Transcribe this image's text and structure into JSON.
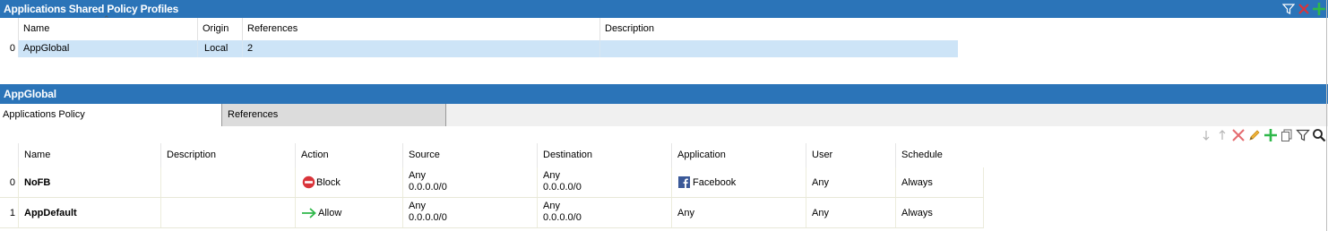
{
  "profiles_panel": {
    "title": "Applications Shared Policy Profiles",
    "columns": [
      "Name",
      "Origin",
      "References",
      "Description"
    ],
    "rows": [
      {
        "index": "0",
        "name": "AppGlobal",
        "origin": "Local",
        "references": "2",
        "description": ""
      }
    ]
  },
  "detail_panel": {
    "title": "AppGlobal",
    "tabs": [
      "Applications Policy",
      "References"
    ]
  },
  "policy_grid": {
    "columns": [
      "Name",
      "Description",
      "Action",
      "Source",
      "Destination",
      "Application",
      "User",
      "Schedule"
    ],
    "rows": [
      {
        "index": "0",
        "name": "NoFB",
        "description": "",
        "action": "Block",
        "action_icon": "block-icon",
        "source_line1": "Any",
        "source_line2": "0.0.0.0/0",
        "dest_line1": "Any",
        "dest_line2": "0.0.0.0/0",
        "application": "Facebook",
        "app_icon": "facebook-icon",
        "user": "Any",
        "schedule": "Always"
      },
      {
        "index": "1",
        "name": "AppDefault",
        "description": "",
        "action": "Allow",
        "action_icon": "arrow-right-icon",
        "source_line1": "Any",
        "source_line2": "0.0.0.0/0",
        "dest_line1": "Any",
        "dest_line2": "0.0.0.0/0",
        "application": "Any",
        "user": "Any",
        "schedule": "Always"
      }
    ]
  },
  "colors": {
    "header_blue": "#2b74b8",
    "selected_row": "#cde4f7",
    "delete_red": "#d9343a",
    "add_green": "#2fb84a"
  }
}
